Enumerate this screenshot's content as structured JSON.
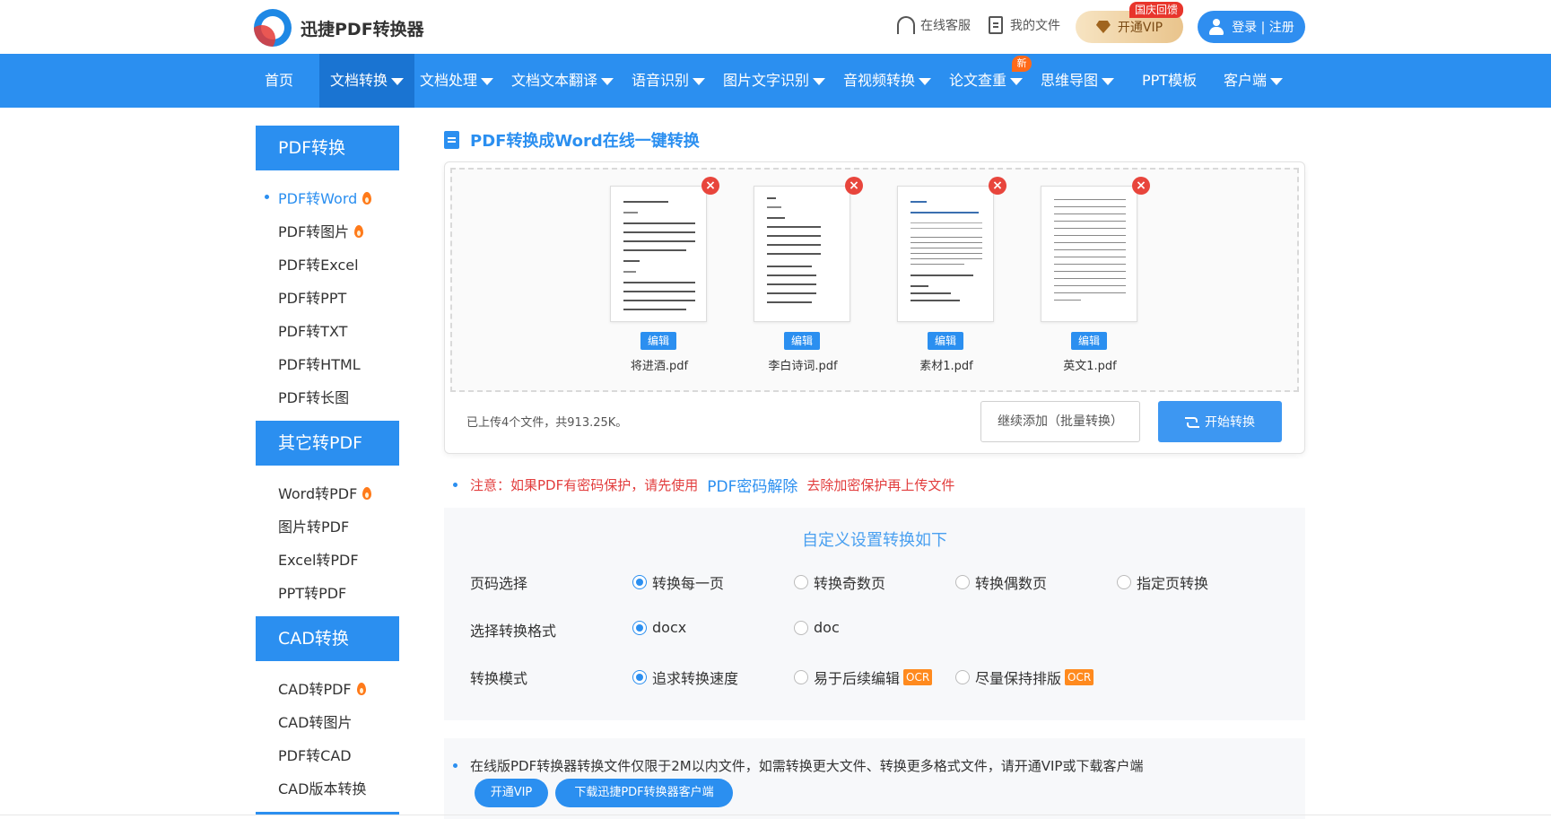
{
  "header": {
    "logo_text": "迅捷PDF转换器",
    "online_service": "在线客服",
    "my_files": "我的文件",
    "vip_label": "开通VIP",
    "vip_tag": "国庆回馈",
    "login_label": "登录 | 注册"
  },
  "nav": {
    "items": [
      {
        "label": "首页"
      },
      {
        "label": "文档转换"
      },
      {
        "label": "文档处理"
      },
      {
        "label": "文档文本翻译"
      },
      {
        "label": "语音识别"
      },
      {
        "label": "图片文字识别"
      },
      {
        "label": "音视频转换"
      },
      {
        "label": "论文查重"
      },
      {
        "label": "思维导图"
      },
      {
        "label": "PPT模板"
      },
      {
        "label": "客户端"
      }
    ],
    "active": "文档转换",
    "new_badge": "新"
  },
  "sidebar": {
    "sections": [
      {
        "title": "PDF转换",
        "items": [
          "PDF转Word",
          "PDF转图片",
          "PDF转Excel",
          "PDF转PPT",
          "PDF转TXT",
          "PDF转HTML",
          "PDF转长图"
        ]
      },
      {
        "title": "其它转PDF",
        "items": [
          "Word转PDF",
          "图片转PDF",
          "Excel转PDF",
          "PPT转PDF"
        ]
      },
      {
        "title": "CAD转换",
        "items": [
          "CAD转PDF",
          "CAD转图片",
          "PDF转CAD",
          "CAD版本转换"
        ]
      }
    ],
    "active_item": "PDF转Word"
  },
  "main": {
    "title": "PDF转换成Word在线一键转换",
    "files": [
      {
        "name": "将进酒.pdf",
        "edit": "编辑"
      },
      {
        "name": "李白诗词.pdf",
        "edit": "编辑"
      },
      {
        "name": "素材1.pdf",
        "edit": "编辑"
      },
      {
        "name": "英文1.pdf",
        "edit": "编辑"
      }
    ],
    "upload_status": "已上传4个文件，共913.25K。",
    "add_more": "继续添加（批量转换）",
    "start": "开始转换"
  },
  "notice": {
    "prefix": "注意：如果PDF有密码保护，请先使用",
    "link": "PDF密码解除",
    "suffix": "去除加密保护再上传文件"
  },
  "settings": {
    "title": "自定义设置转换如下",
    "page_label": "页码选择",
    "page_options": [
      "转换每一页",
      "转换奇数页",
      "转换偶数页",
      "指定页转换"
    ],
    "page_selected": "转换每一页",
    "format_label": "选择转换格式",
    "format_options": [
      "docx",
      "doc"
    ],
    "format_selected": "docx",
    "mode_label": "转换模式",
    "mode_options": [
      "追求转换速度",
      "易于后续编辑",
      "尽量保持排版"
    ],
    "mode_selected": "追求转换速度",
    "ocr_tag": "OCR"
  },
  "info": {
    "text": "在线版PDF转换器转换文件仅限于2M以内文件，如需转换更大文件、转换更多格式文件，请开通VIP或下载客户端",
    "vip_button": "开通VIP",
    "download_button": "下载迅捷PDF转换器客户端"
  },
  "colors": {
    "brand": "#2b8ff0",
    "nav_active": "#1a74d2",
    "warning": "#e23d3d",
    "ocr": "#ff8a1e"
  }
}
